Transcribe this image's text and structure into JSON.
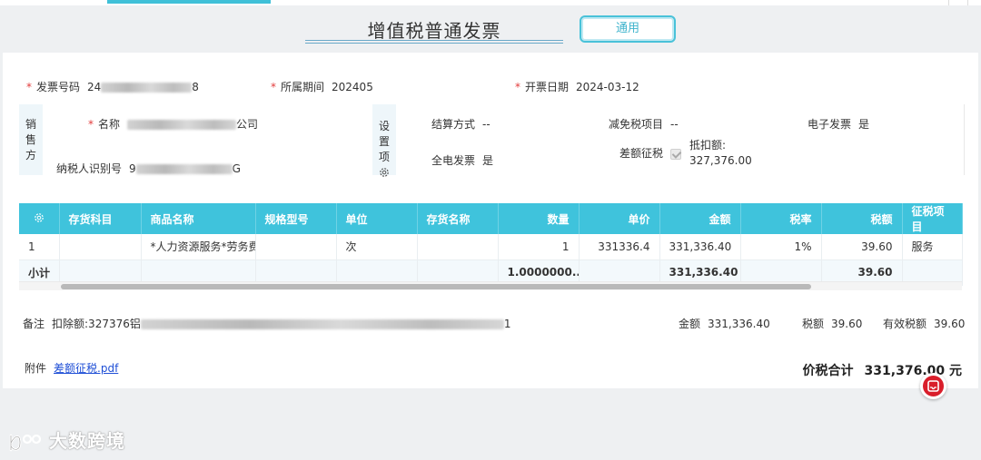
{
  "header": {
    "title": "增值税普通发票",
    "tag_button": "通用"
  },
  "invoice": {
    "invoice_no_label": "发票号码",
    "invoice_no_start": "24",
    "invoice_no_end": "8",
    "period_label": "所属期间",
    "period_value": "202405",
    "issue_date_label": "开票日期",
    "issue_date_value": "2024-03-12"
  },
  "seller": {
    "section_label": "销售方",
    "name_label": "名称",
    "name_suffix": "公司",
    "tax_id_label": "纳税人识别号",
    "tax_id_start": "9",
    "tax_id_end": "G"
  },
  "settings": {
    "section_label": "设置项",
    "settle_label": "结算方式",
    "settle_value": "--",
    "tax_free_label": "减免税项目",
    "tax_free_value": "--",
    "e_invoice_label": "电子发票",
    "e_invoice_value": "是",
    "full_e_label": "全电发票",
    "full_e_value": "是",
    "diff_tax_label": "差额征税",
    "deduct_label": "抵扣额:",
    "deduct_value": "327,376.00"
  },
  "table": {
    "columns": [
      "存货科目",
      "商品名称",
      "规格型号",
      "单位",
      "存货名称",
      "数量",
      "单价",
      "金额",
      "税率",
      "税额",
      "征税项目"
    ],
    "rows": [
      [
        "1",
        "",
        "*人力资源服务*劳务费",
        "",
        "次",
        "",
        "1",
        "331336.4",
        "331,336.40",
        "1%",
        "39.60",
        "服务"
      ]
    ],
    "subtotal": [
      "小计",
      "",
      "",
      "",
      "",
      "",
      "1.0000000...",
      "",
      "331,336.40",
      "",
      "39.60",
      ""
    ]
  },
  "remark": {
    "label": "备注",
    "text_start": "扣除额:327376铝",
    "text_end": "1",
    "amount_label": "金额",
    "amount_value": "331,336.40",
    "tax_label": "税额",
    "tax_value": "39.60",
    "valid_tax_label": "有效税额",
    "valid_tax_value": "39.60"
  },
  "attachment": {
    "label": "附件",
    "file": "差额征税.pdf"
  },
  "total": {
    "label": "价税合计",
    "value": "331,376.00 元"
  },
  "watermark": "大数跨境",
  "colors": {
    "accent": "#3fc3dc",
    "required": "#e23b3b",
    "link": "#1f4fd6",
    "fab": "#d91e2b"
  }
}
